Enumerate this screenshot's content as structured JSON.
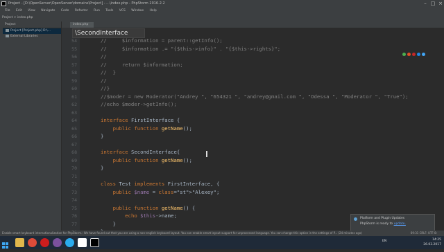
{
  "window": {
    "title": "Project - [D:\\OpenServer\\OpenServer\\domains\\Project] - ...\\index.php - PhpStorm 2016.2.2"
  },
  "menu": [
    "File",
    "Edit",
    "View",
    "Navigate",
    "Code",
    "Refactor",
    "Run",
    "Tools",
    "VCS",
    "Window",
    "Help"
  ],
  "toolbar": {
    "path": "Project  >  index.php"
  },
  "project_panel": {
    "header": "Project",
    "root": "Project [Project.php]  D:\\...",
    "external": "External Libraries"
  },
  "tab": {
    "label": "index.php"
  },
  "breadcrumb": "\\SecondInterface",
  "lines": [
    {
      "n": "54",
      "text": "//     $information = parent::getInfo();",
      "cls": "cm"
    },
    {
      "n": "55",
      "text": "//     $information .= \"{$this->info}\" . \"{$this->rights}\";",
      "cls": "cm"
    },
    {
      "n": "56",
      "text": "//",
      "cls": "cm"
    },
    {
      "n": "57",
      "text": "//     return $information;",
      "cls": "cm"
    },
    {
      "n": "58",
      "text": "//  }",
      "cls": "cm"
    },
    {
      "n": "59",
      "text": "//",
      "cls": "cm"
    },
    {
      "n": "60",
      "text": "//}",
      "cls": "cm"
    },
    {
      "n": "61",
      "text": "//$moder = new Moderator(\"Andrey \", \"654321 \", \"andrey@gmail.com \", \"Odessa \", \"Moderator \", \"True\");",
      "cls": "cm"
    },
    {
      "n": "62",
      "text": "//echo $moder->getInfo();",
      "cls": "cm"
    },
    {
      "n": "63",
      "text": "",
      "cls": ""
    },
    {
      "n": "64",
      "text": "interface FirstInterface {",
      "cls": "kw"
    },
    {
      "n": "65",
      "text": "    public function getName();",
      "cls": "kw"
    },
    {
      "n": "66",
      "text": "}",
      "cls": ""
    },
    {
      "n": "67",
      "text": "",
      "cls": ""
    },
    {
      "n": "68",
      "text": "interface SecondInterface{",
      "cls": "kw"
    },
    {
      "n": "69",
      "text": "    public function getName();",
      "cls": "kw"
    },
    {
      "n": "70",
      "text": "}",
      "cls": ""
    },
    {
      "n": "71",
      "text": "",
      "cls": ""
    },
    {
      "n": "72",
      "text": "class Test implements FirstInterface, {",
      "cls": "kw"
    },
    {
      "n": "73",
      "text": "    public $name = \"Alexey\";",
      "cls": "kw"
    },
    {
      "n": "74",
      "text": "",
      "cls": ""
    },
    {
      "n": "75",
      "text": "    public function getName() {",
      "cls": "kw"
    },
    {
      "n": "76",
      "text": "        echo $this->name;",
      "cls": "kw"
    },
    {
      "n": "77",
      "text": "    }",
      "cls": ""
    },
    {
      "n": "78",
      "text": "}",
      "cls": ""
    }
  ],
  "notification": {
    "title": "Platform and Plugin Updates",
    "body": "PhpStorm is ready to",
    "link": "update."
  },
  "status": {
    "message": "Enable smart keyboard internationalization for PhpStorm.: We have found out that you are using a non-english keyboard layout. You can enable smart layout support for unprocessed language. You can change this option in the settings of P... (24 minutes ago)",
    "right": "69:31  CRLF:  UTF-8:"
  },
  "taskbar": {
    "lang": "EN",
    "time": "14:25",
    "date": "26.03.2017"
  },
  "colors": {
    "editor_bg": "#2b2b2b",
    "keyword": "#cc7832",
    "comment": "#808080",
    "string": "#6a8759",
    "function": "#ffc66d"
  }
}
